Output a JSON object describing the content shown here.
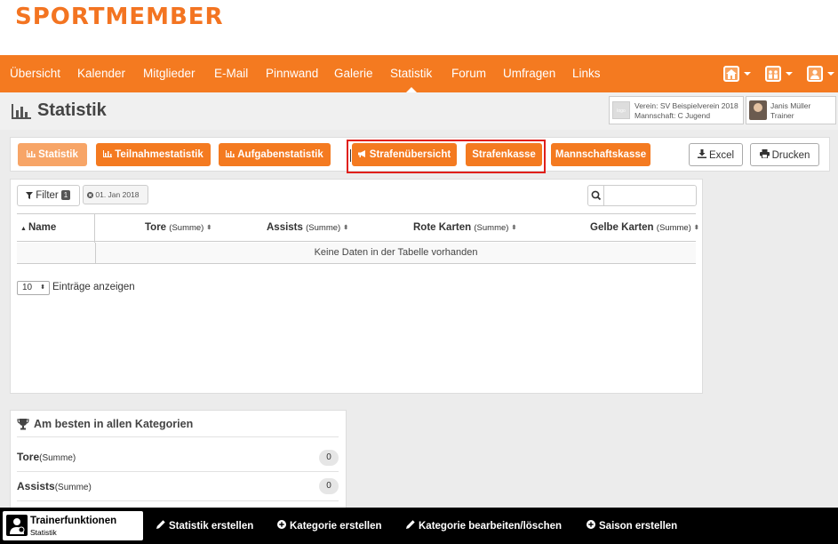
{
  "brand": {
    "logo_text": "SPORTMEMBER",
    "accent": "#f47a20"
  },
  "nav": {
    "items": [
      {
        "label": "Übersicht"
      },
      {
        "label": "Kalender"
      },
      {
        "label": "Mitglieder"
      },
      {
        "label": "E-Mail"
      },
      {
        "label": "Pinnwand"
      },
      {
        "label": "Galerie"
      },
      {
        "label": "Statistik",
        "active": true
      },
      {
        "label": "Forum"
      },
      {
        "label": "Umfragen"
      },
      {
        "label": "Links"
      }
    ],
    "right_icons": [
      "home-icon",
      "team-icon",
      "user-icon"
    ]
  },
  "page": {
    "title": "Statistik",
    "title_icon": "bar-chart-icon"
  },
  "context": {
    "club_logo_text": "logo",
    "club_line": "Verein: SV Beispielverein 2018",
    "team_line": "Mannschaft: C Jugend",
    "user_name": "Janis Müller",
    "user_role": "Trainer"
  },
  "tabs": {
    "statistik": "Statistik",
    "teilnahme": "Teilnahmestatistik",
    "aufgaben": "Aufgabenstatistik",
    "strafen_uebersicht": "Strafenübersicht",
    "strafenkasse": "Strafenkasse",
    "mannschaftskasse": "Mannschaftskasse",
    "excel": "Excel",
    "drucken": "Drucken"
  },
  "table": {
    "filter_label": "Filter",
    "filter_count": "1",
    "date_chip": "01. Jan 2018",
    "search_placeholder": "",
    "columns": [
      {
        "label": "Name",
        "suffix": ""
      },
      {
        "label": "Tore",
        "suffix": "(Summe)"
      },
      {
        "label": "Assists",
        "suffix": "(Summe)"
      },
      {
        "label": "Rote Karten",
        "suffix": "(Summe)"
      },
      {
        "label": "Gelbe Karten",
        "suffix": "(Summe)"
      }
    ],
    "empty_text": "Keine Daten in der Tabelle vorhanden",
    "page_length": "10",
    "page_length_label": "Einträge anzeigen"
  },
  "best": {
    "title": "Am besten in allen Kategorien",
    "rows": [
      {
        "label": "Tore",
        "suffix": "(Summe)",
        "count": "0"
      },
      {
        "label": "Assists",
        "suffix": "(Summe)",
        "count": "0"
      }
    ]
  },
  "bottom": {
    "card_title": "Trainerfunktionen",
    "card_subtitle": "Statistik",
    "actions": [
      {
        "label": "Statistik erstellen",
        "icon": "pencil-icon"
      },
      {
        "label": "Kategorie erstellen",
        "icon": "plus-circle-icon"
      },
      {
        "label": "Kategorie bearbeiten/löschen",
        "icon": "pencil-icon"
      },
      {
        "label": "Saison erstellen",
        "icon": "plus-circle-icon"
      }
    ]
  }
}
